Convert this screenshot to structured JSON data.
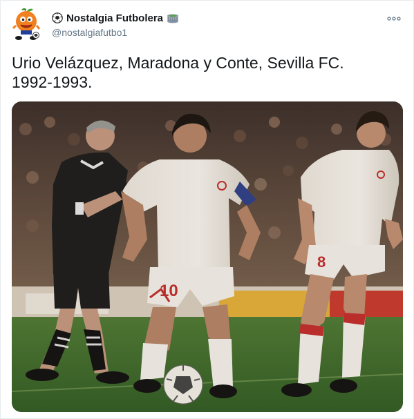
{
  "tweet": {
    "author": {
      "display_name": "Nostalgia Futbolera",
      "handle": "@nostalgiafutbo1",
      "name_prefix_icon": "soccer-ball-icon",
      "name_suffix_icon": "stadium-icon",
      "avatar_icon": "orange-mascot-avatar"
    },
    "menu_icon": "more-options-icon",
    "text": "Urio Velázquez,  Maradona y Conte, Sevilla FC.\n1992-1993.",
    "photo": {
      "kit_numbers": [
        "10",
        "8"
      ],
      "colors": {
        "kit": "#f4f1ec",
        "referee": "#1c1c1c",
        "pitch": "#3d6e2e",
        "stands": "#4a3c34",
        "accent_red": "#c22c2c"
      }
    }
  }
}
